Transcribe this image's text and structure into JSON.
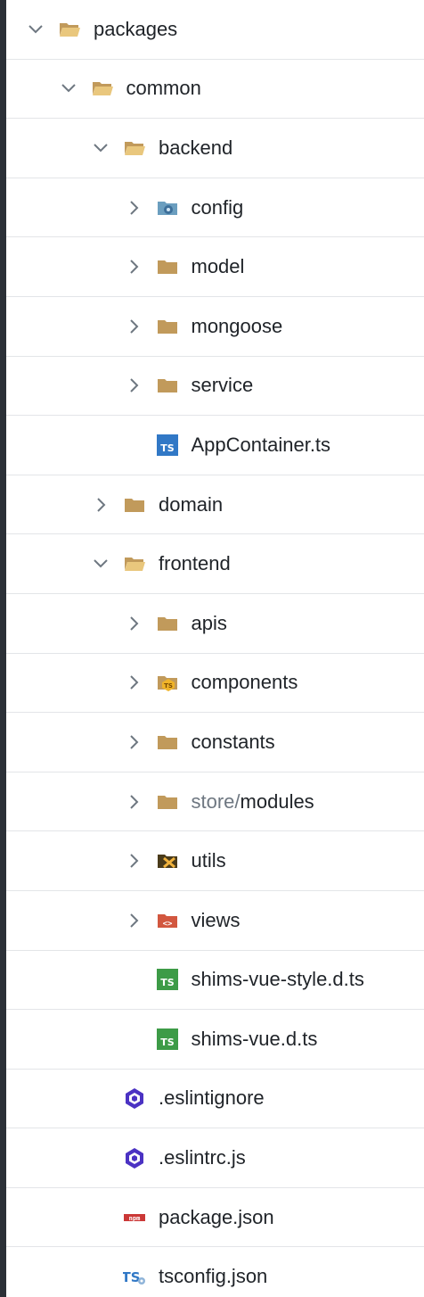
{
  "tree": [
    {
      "label": "packages",
      "icon": "folder-open-icon",
      "expanded": true,
      "level": 0
    },
    {
      "label": "common",
      "icon": "folder-open-icon",
      "expanded": true,
      "level": 1
    },
    {
      "label": "backend",
      "icon": "folder-open-icon",
      "expanded": true,
      "level": 2
    },
    {
      "label": "config",
      "icon": "folder-config-icon",
      "expanded": false,
      "level": 3
    },
    {
      "label": "model",
      "icon": "folder-icon",
      "expanded": false,
      "level": 3
    },
    {
      "label": "mongoose",
      "icon": "folder-icon",
      "expanded": false,
      "level": 3
    },
    {
      "label": "service",
      "icon": "folder-icon",
      "expanded": false,
      "level": 3
    },
    {
      "label": "AppContainer.ts",
      "icon": "typescript-file-icon",
      "level": 3
    },
    {
      "label": "domain",
      "icon": "folder-icon",
      "expanded": false,
      "level": 2
    },
    {
      "label": "frontend",
      "icon": "folder-open-icon",
      "expanded": true,
      "level": 2
    },
    {
      "label": "apis",
      "icon": "folder-icon",
      "expanded": false,
      "level": 3
    },
    {
      "label": "components",
      "icon": "folder-components-icon",
      "expanded": false,
      "level": 3
    },
    {
      "label": "constants",
      "icon": "folder-icon",
      "expanded": false,
      "level": 3
    },
    {
      "label": "store/",
      "label_suffix": "modules",
      "icon": "folder-icon",
      "expanded": false,
      "level": 3
    },
    {
      "label": "utils",
      "icon": "folder-utils-icon",
      "expanded": false,
      "level": 3
    },
    {
      "label": "views",
      "icon": "folder-views-icon",
      "expanded": false,
      "level": 3
    },
    {
      "label": "shims-vue-style.d.ts",
      "icon": "typescript-def-icon",
      "level": 3
    },
    {
      "label": "shims-vue.d.ts",
      "icon": "typescript-def-icon",
      "level": 3
    },
    {
      "label": ".eslintignore",
      "icon": "eslint-icon",
      "level": 2
    },
    {
      "label": ".eslintrc.js",
      "icon": "eslint-icon",
      "level": 2
    },
    {
      "label": "package.json",
      "icon": "npm-icon",
      "level": 2
    },
    {
      "label": "tsconfig.json",
      "icon": "tsconfig-icon",
      "level": 2
    }
  ],
  "colors": {
    "folder": "#c19a5b",
    "folder_open": "#e9c77d",
    "typescript_blue": "#3178c6",
    "typescript_green": "#3d9b47",
    "eslint": "#4b32c3",
    "npm": "#cb3837",
    "views": "#d2573f",
    "chevron": "#6e7781",
    "text": "#1f2328",
    "separator": "#e3e5e8"
  }
}
